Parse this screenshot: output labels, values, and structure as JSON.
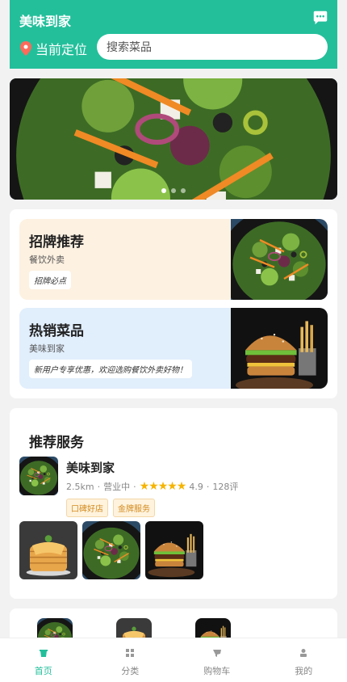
{
  "header": {
    "brand": "美味到家",
    "location_label": "当前定位",
    "search_placeholder": "搜索菜品",
    "accent": "#23bf9b"
  },
  "banner": {
    "image": "salad-photo",
    "dots": 3
  },
  "promos": [
    {
      "title": "招牌推荐",
      "subtitle": "餐饮外卖",
      "tag": "招牌必点",
      "bg": "#fdf1e1",
      "image": "salad-photo"
    },
    {
      "title": "热销菜品",
      "subtitle": "美味到家",
      "tag": "新用户专享优惠，欢迎选购餐饮外卖好物！",
      "bg": "#e1eefc",
      "image": "burger-photo"
    }
  ],
  "service": {
    "heading": "推荐服务",
    "shop": {
      "name": "美味到家",
      "distance": "2.5km",
      "status": "营业中",
      "stars": "★★★★★",
      "rating": "4.9",
      "reviews": "128评",
      "badges": [
        "口碑好店",
        "金牌服务"
      ]
    },
    "gallery": [
      "pancake-photo",
      "salad-photo",
      "burger-photo"
    ]
  },
  "tabbar": [
    {
      "label": "首页",
      "icon": "home-icon",
      "active": true
    },
    {
      "label": "分类",
      "icon": "grid-icon",
      "active": false
    },
    {
      "label": "购物车",
      "icon": "cart-icon",
      "active": false
    },
    {
      "label": "我的",
      "icon": "user-icon",
      "active": false
    }
  ]
}
